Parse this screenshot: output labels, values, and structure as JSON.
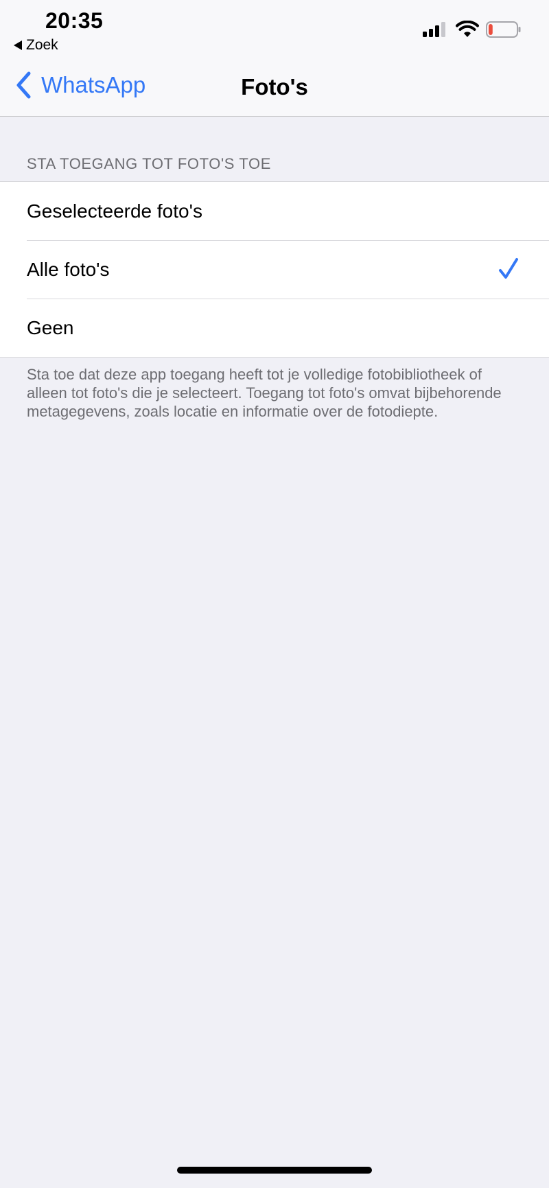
{
  "status_bar": {
    "time": "20:35",
    "back_app_label": "Zoek",
    "signal_icon": "cellular-signal-icon",
    "wifi_icon": "wifi-icon",
    "battery_icon": "battery-low-icon",
    "battery_level_fraction": 0.15,
    "battery_color": "#eb4d3d"
  },
  "nav": {
    "back_label": "WhatsApp",
    "title": "Foto's",
    "accent_color": "#3478f6"
  },
  "section": {
    "header": "STA TOEGANG TOT FOTO'S TOE",
    "options": [
      {
        "label": "Geselecteerde foto's",
        "selected": false
      },
      {
        "label": "Alle foto's",
        "selected": true
      },
      {
        "label": "Geen",
        "selected": false
      }
    ],
    "footer": "Sta toe dat deze app toegang heeft tot je volledige fotobibliotheek of alleen tot foto's die je selecteert. Toegang tot foto's omvat bijbehorende metagegevens, zoals locatie en informatie over de fotodiepte."
  }
}
